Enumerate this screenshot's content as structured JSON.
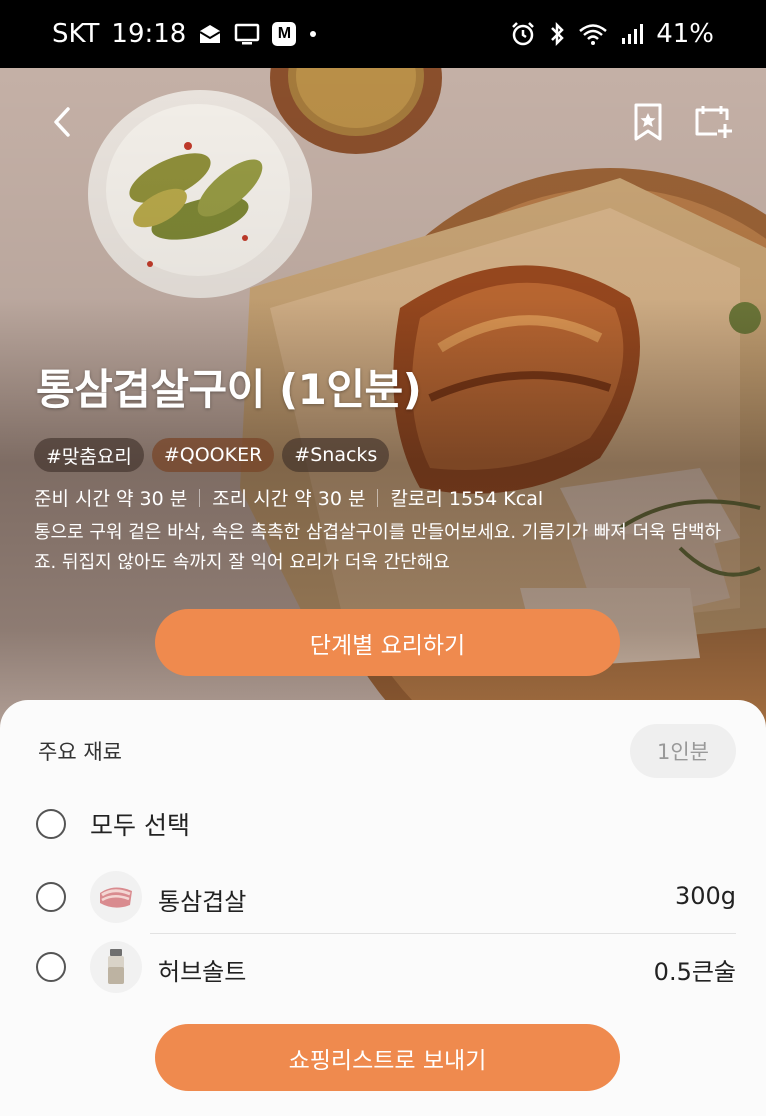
{
  "status_bar": {
    "carrier": "SKT",
    "time": "19:18",
    "battery": "41%",
    "icons": [
      "mail-icon",
      "cast-icon",
      "m-app-icon",
      "dot-icon",
      "alarm-icon",
      "bluetooth-icon",
      "wifi-icon",
      "signal-icon"
    ]
  },
  "header": {
    "back_icon": "chevron-left-icon",
    "bookmark_icon": "bookmark-star-icon",
    "calendar_icon": "calendar-add-icon"
  },
  "recipe": {
    "title": "통삼겹살구이 (1인분)",
    "tags": [
      "#맞춤요리",
      "#QOOKER",
      "#Snacks"
    ],
    "prep_time": "준비 시간 약 30 분",
    "cook_time": "조리 시간 약 30 분",
    "calories": "칼로리 1554 Kcal",
    "description": "통으로 구워 겉은 바삭, 속은 촉촉한 삼겹살구이를 만들어보세요. 기름기가 빠져 더욱 담백하죠. 뒤집지 않아도 속까지 잘 익어 요리가 더욱 간단해요",
    "cook_button": "단계별 요리하기"
  },
  "ingredients": {
    "title": "주요 재료",
    "servings": "1인분",
    "select_all": "모두 선택",
    "items": [
      {
        "name": "통삼겹살",
        "amount": "300g",
        "icon": "pork-icon"
      },
      {
        "name": "허브솔트",
        "amount": "0.5큰술",
        "icon": "salt-shaker-icon"
      }
    ],
    "shopping_button": "쇼핑리스트로 보내기"
  },
  "colors": {
    "accent": "#ef8a4e",
    "sheet_bg": "#fbfbfb"
  }
}
